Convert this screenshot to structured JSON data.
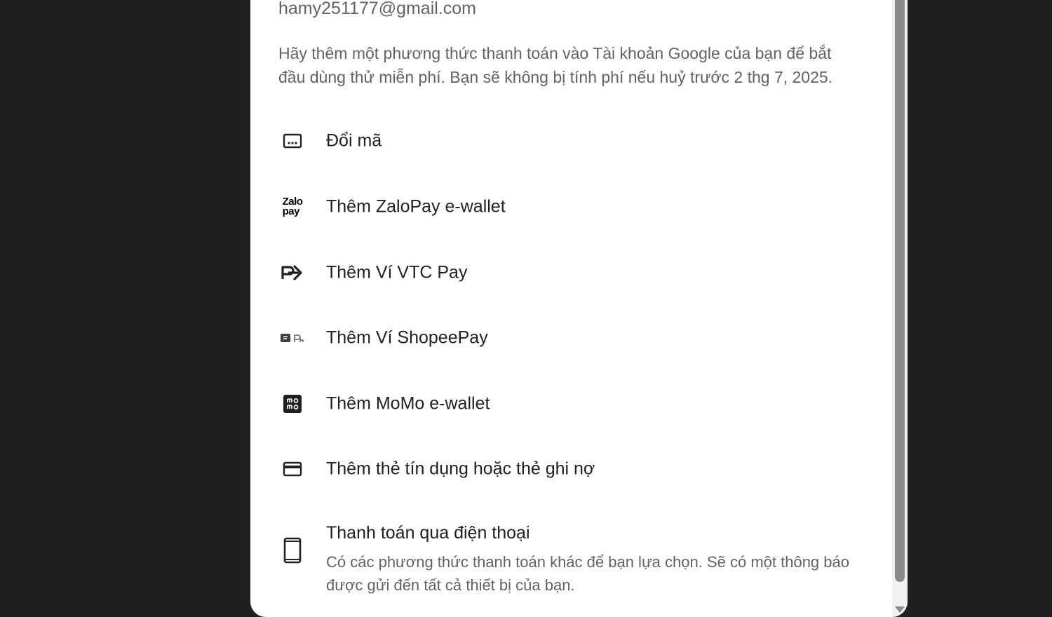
{
  "account": {
    "email": "hamy251177@gmail.com"
  },
  "description": "Hãy thêm một phương thức thanh toán vào Tài khoản Google của bạn để bắt đầu dùng thử miễn phí. Bạn sẽ không bị tính phí nếu huỷ trước 2 thg 7, 2025.",
  "options": [
    {
      "label": "Đổi mã",
      "icon": "redeem-code-icon"
    },
    {
      "label": "Thêm ZaloPay e-wallet",
      "icon": "zalopay-icon",
      "icon_text_top": "Zalo",
      "icon_text_bottom": "pay"
    },
    {
      "label": "Thêm Ví VTC Pay",
      "icon": "vtc-pay-icon"
    },
    {
      "label": "Thêm Ví ShopeePay",
      "icon": "shopeepay-icon"
    },
    {
      "label": "Thêm MoMo e-wallet",
      "icon": "momo-icon"
    },
    {
      "label": "Thêm thẻ tín dụng hoặc thẻ ghi nợ",
      "icon": "credit-card-icon"
    },
    {
      "label": "Thanh toán qua điện thoại",
      "sublabel": "Có các phương thức thanh toán khác để bạn lựa chọn. Sẽ có một thông báo được gửi đến tất cả thiết bị của bạn.",
      "icon": "phone-icon"
    }
  ],
  "colors": {
    "background": "#1f2022",
    "dialog": "#ffffff",
    "primary_text": "#202124",
    "secondary_text": "#5f6368"
  }
}
